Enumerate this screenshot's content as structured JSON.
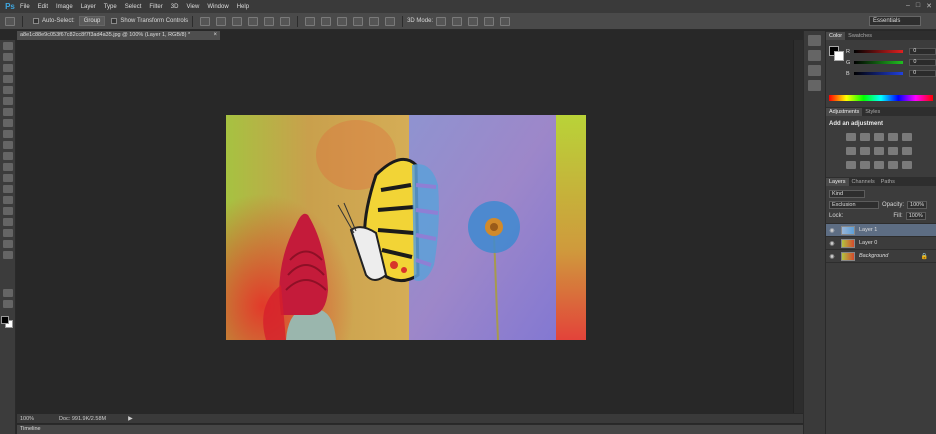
{
  "app": {
    "logo": "Ps",
    "menu": [
      "File",
      "Edit",
      "Image",
      "Layer",
      "Type",
      "Select",
      "Filter",
      "3D",
      "View",
      "Window",
      "Help"
    ],
    "window_controls": [
      "–",
      "□",
      "✕"
    ]
  },
  "options_bar": {
    "auto_select_label": "Auto-Select:",
    "auto_select_value": "Group",
    "transform_label": "Show Transform Controls",
    "mode_3d_label": "3D Mode:",
    "workspace": "Essentials"
  },
  "document": {
    "tab_title": "a8e1c88e9c053f67c82cc8f7f3ad4a35.jpg @ 100% (Layer 1, RGB/8) *",
    "close_glyph": "×"
  },
  "status": {
    "zoom": "100%",
    "doc_size": "Doc: 991.9K/2.58M",
    "arrow": "▶"
  },
  "timeline_label": "Timeline",
  "color_panel": {
    "tabs": [
      "Color",
      "Swatches"
    ],
    "rows": [
      {
        "label": "R",
        "value": "0",
        "color": "#e02020"
      },
      {
        "label": "G",
        "value": "0",
        "color": "#20c020"
      },
      {
        "label": "B",
        "value": "0",
        "color": "#2040e0"
      }
    ]
  },
  "adjustments_panel": {
    "tabs": [
      "Adjustments",
      "Styles"
    ],
    "title": "Add an adjustment"
  },
  "layers_panel": {
    "tabs": [
      "Layers",
      "Channels",
      "Paths"
    ],
    "filter_kind": "Kind",
    "blend_mode": "Exclusion",
    "opacity_label": "Opacity:",
    "opacity_value": "100%",
    "lock_label": "Lock:",
    "fill_label": "Fill:",
    "fill_value": "100%",
    "layers": [
      {
        "name": "Layer 1",
        "selected": true
      },
      {
        "name": "Layer 0",
        "selected": false
      },
      {
        "name": "Background",
        "selected": false
      }
    ]
  },
  "colors": {
    "accent": "#3fa7e0",
    "selection": "#5d6d83"
  }
}
